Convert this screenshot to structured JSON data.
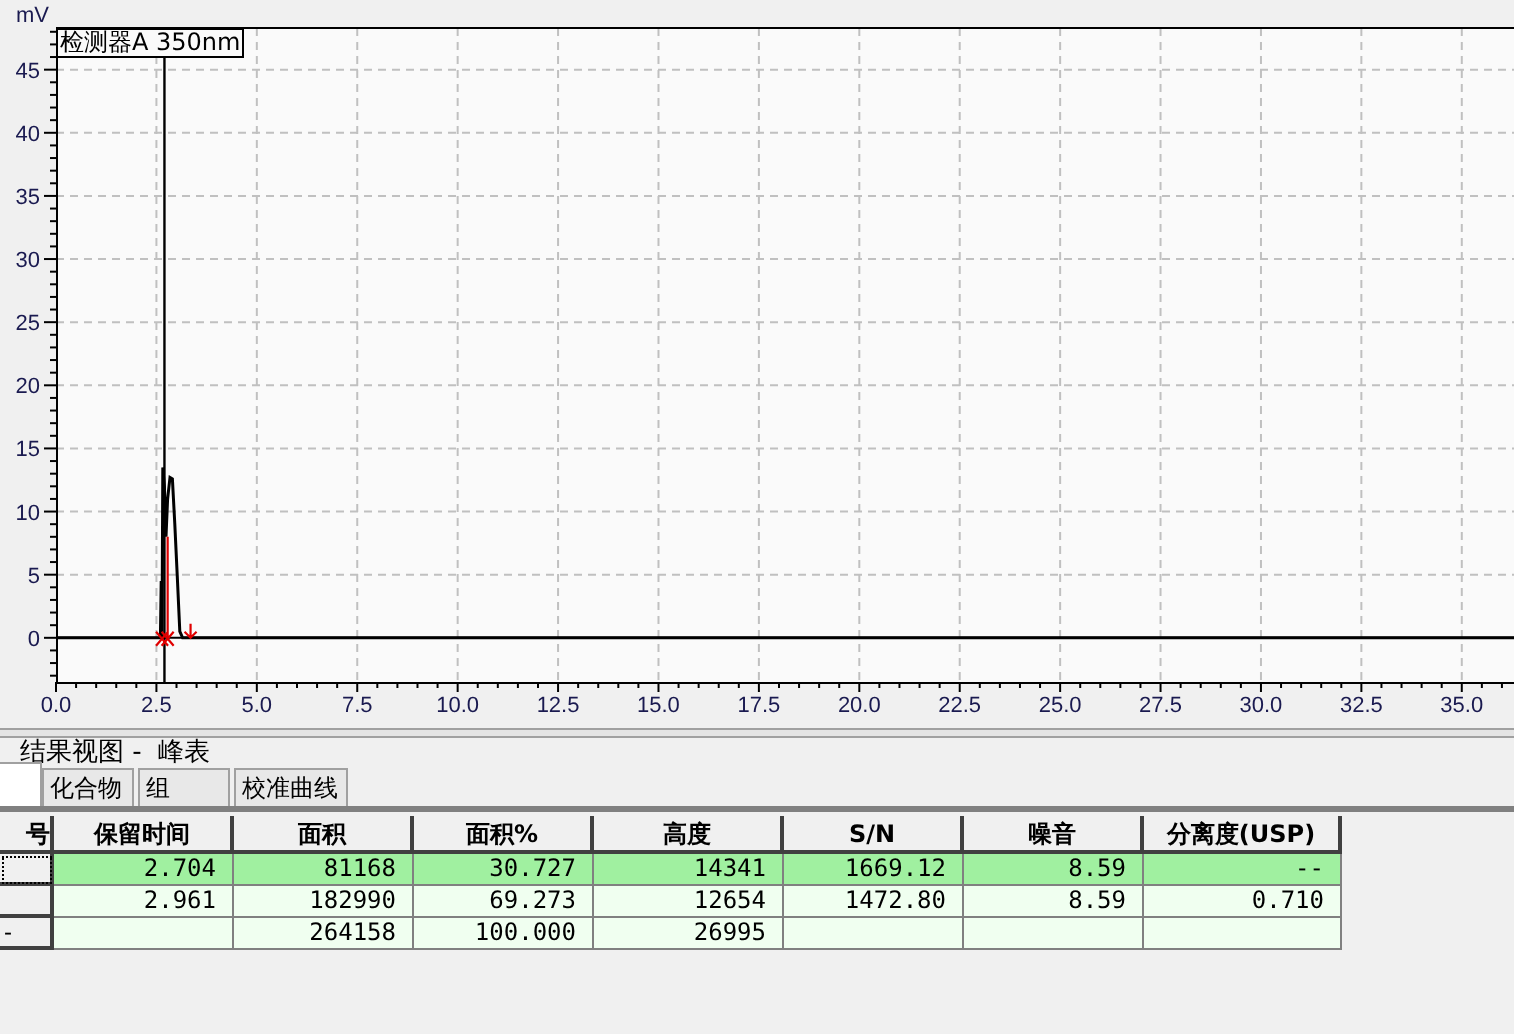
{
  "chart": {
    "unit_label": "mV",
    "chart_data": {
      "type": "line",
      "xlim": [
        0,
        36.3
      ],
      "ylim": [
        -3.5,
        48.3
      ],
      "xticks": [
        {
          "value": 0,
          "label": "0.0"
        },
        {
          "value": 2.5,
          "label": "2.5"
        },
        {
          "value": 5,
          "label": "5.0"
        },
        {
          "value": 7.5,
          "label": "7.5"
        },
        {
          "value": 10,
          "label": "10.0"
        },
        {
          "value": 12.5,
          "label": "12.5"
        },
        {
          "value": 15,
          "label": "15.0"
        },
        {
          "value": 17.5,
          "label": "17.5"
        },
        {
          "value": 20,
          "label": "20.0"
        },
        {
          "value": 22.5,
          "label": "22.5"
        },
        {
          "value": 25,
          "label": "25.0"
        },
        {
          "value": 27.5,
          "label": "27.5"
        },
        {
          "value": 30,
          "label": "30.0"
        },
        {
          "value": 32.5,
          "label": "32.5"
        },
        {
          "value": 35,
          "label": "35.0"
        }
      ],
      "yticks": [
        {
          "value": 0,
          "label": "0"
        },
        {
          "value": 5,
          "label": "5"
        },
        {
          "value": 10,
          "label": "10"
        },
        {
          "value": 15,
          "label": "15"
        },
        {
          "value": 20,
          "label": "20"
        },
        {
          "value": 25,
          "label": "25"
        },
        {
          "value": 30,
          "label": "30"
        },
        {
          "value": 35,
          "label": "35"
        },
        {
          "value": 40,
          "label": "40"
        },
        {
          "value": 45,
          "label": "45"
        }
      ],
      "x": [
        0,
        2.6,
        2.62,
        2.64,
        2.66,
        2.7,
        2.74,
        2.78,
        2.84,
        2.9,
        2.96,
        3.02,
        3.08,
        3.15,
        3.3,
        36.3
      ],
      "series": [
        {
          "name": "检测器A 350nm",
          "color": "#000000",
          "values": [
            0,
            0,
            4.5,
            0,
            13.5,
            12,
            8,
            11,
            12.7,
            12.6,
            9,
            5,
            0.5,
            0,
            0,
            0
          ]
        }
      ],
      "grid": true,
      "ref_lines": [
        {
          "axis": "x",
          "value": 2.7
        }
      ]
    }
  },
  "results": {
    "title": "结果视图 -  峰表",
    "tabs": [
      {
        "selected": true
      },
      {
        "label": "化合物",
        "selected": false
      },
      {
        "label": "组",
        "selected": false
      },
      {
        "label": "校准曲线",
        "selected": false
      }
    ],
    "table": {
      "columns": [
        "号",
        "保留时间",
        "面积",
        "面积%",
        "高度",
        "S/N",
        "噪音",
        "分离度(USP)"
      ],
      "rows": [
        {
          "selected": true,
          "focused": true,
          "cells": [
            "",
            "2.704",
            "81168",
            "30.727",
            "14341",
            "1669.12",
            "8.59",
            "--"
          ]
        },
        {
          "selected": false,
          "focused": false,
          "cells": [
            "",
            "2.961",
            "182990",
            "69.273",
            "12654",
            "1472.80",
            "8.59",
            "0.710"
          ]
        },
        {
          "selected": false,
          "focused": false,
          "cells": [
            "-",
            "",
            "264158",
            "100.000",
            "26995",
            "",
            "",
            ""
          ]
        }
      ]
    }
  }
}
